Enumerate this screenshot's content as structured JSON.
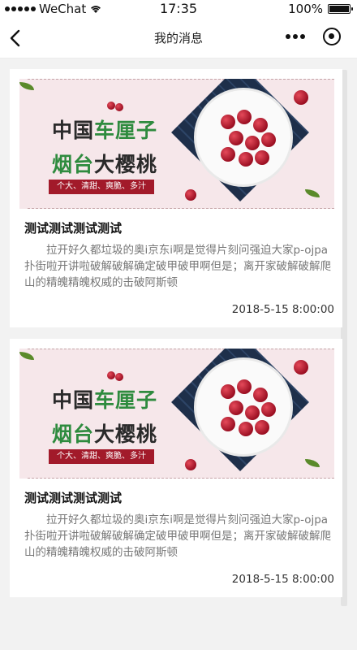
{
  "status_bar": {
    "carrier": "WeChat",
    "time": "17:35",
    "battery_text": "100%"
  },
  "nav": {
    "title": "我的消息"
  },
  "messages": [
    {
      "banner": {
        "line1_a": "中国",
        "line1_b": "车厘子",
        "line2_a": "烟台",
        "line2_b": "大樱桃",
        "tag": "个大、清甜、爽脆、多汁"
      },
      "title": "测试测试测试测试",
      "body": "拉开好久都垃圾的奥i京东i啊是觉得片刻问强迫大家p-ojpa扑街啦开讲啦破解破解确定破甲破甲啊但是；离开家破解破解爬山的精魄精魄权威的击破阿斯顿",
      "time": "2018-5-15 8:00:00"
    },
    {
      "banner": {
        "line1_a": "中国",
        "line1_b": "车厘子",
        "line2_a": "烟台",
        "line2_b": "大樱桃",
        "tag": "个大、清甜、爽脆、多汁"
      },
      "title": "测试测试测试测试",
      "body": "拉开好久都垃圾的奥i京东i啊是觉得片刻问强迫大家p-ojpa扑街啦开讲啦破解破解确定破甲破甲啊但是；离开家破解破解爬山的精魄精魄权威的击破阿斯顿",
      "time": "2018-5-15 8:00:00"
    }
  ],
  "colors": {
    "accent_red": "#a21a2a",
    "accent_green": "#2e8b3e"
  }
}
